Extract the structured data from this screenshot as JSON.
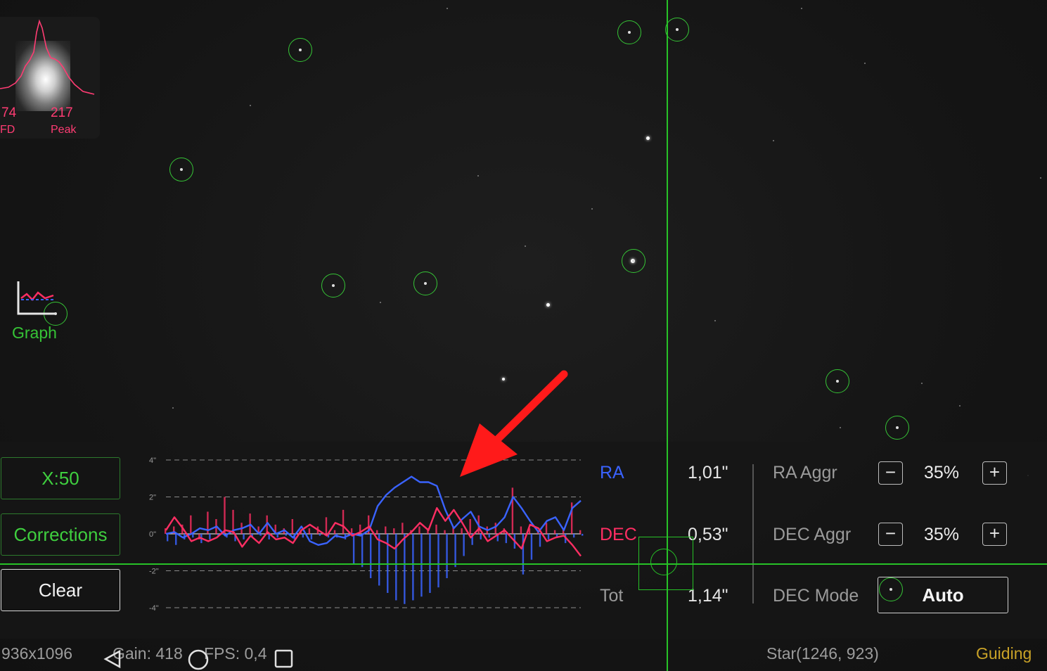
{
  "star_profile": {
    "fwhm_value": "74",
    "fwhm_label": "FD",
    "peak_value": "217",
    "peak_label": "Peak"
  },
  "graph_toggle": {
    "label": "Graph",
    "icon": "graph-icon"
  },
  "controls": {
    "scale_button": "X:50",
    "corrections_button": "Corrections",
    "clear_button": "Clear"
  },
  "stats": {
    "ra_label": "RA",
    "ra_value": "1,01\"",
    "dec_label": "DEC",
    "dec_value": "0,53\"",
    "tot_label": "Tot",
    "tot_value": "1,14\""
  },
  "aggressiveness": {
    "ra_label": "RA Aggr",
    "ra_value": "35%",
    "dec_label": "DEC Aggr",
    "dec_value": "35%",
    "minus": "−",
    "plus": "+",
    "mode_label": "DEC Mode",
    "mode_value": "Auto"
  },
  "status_bar": {
    "resolution": "936x1096",
    "gain": "Gain: 418",
    "fps": "FPS: 0,4",
    "star": "Star(1246, 923)",
    "state": "Guiding"
  },
  "colors": {
    "ra": "#3a63ff",
    "dec": "#ff2e63",
    "accent": "#36c436",
    "guiding": "#c9a227",
    "arrow": "#ff1a1a"
  },
  "chart_data": {
    "type": "line",
    "y_tick_labels": [
      "4\"",
      "2\"",
      "0\"",
      "-2\"",
      "-4\""
    ],
    "ylim": [
      -4,
      4
    ],
    "grid": true,
    "x": [
      1,
      2,
      3,
      4,
      5,
      6,
      7,
      8,
      9,
      10,
      11,
      12,
      13,
      14,
      15,
      16,
      17,
      18,
      19,
      20,
      21,
      22,
      23,
      24,
      25,
      26,
      27,
      28,
      29,
      30,
      31,
      32,
      33,
      34,
      35,
      36,
      37,
      38,
      39,
      40,
      41,
      42,
      43,
      44,
      45,
      46,
      47,
      48,
      49,
      50
    ],
    "series": [
      {
        "name": "RA",
        "color": "#3a63ff",
        "values": [
          0.0,
          0.1,
          -0.2,
          0.0,
          0.3,
          0.2,
          0.4,
          -0.1,
          0.2,
          0.3,
          0.5,
          0.0,
          0.6,
          0.0,
          0.2,
          -0.2,
          0.4,
          -0.4,
          -0.6,
          -0.5,
          -0.1,
          -0.2,
          0.0,
          -0.1,
          0.2,
          1.5,
          2.1,
          2.5,
          2.8,
          3.1,
          2.8,
          2.8,
          2.6,
          1.3,
          0.3,
          0.8,
          1.2,
          0.4,
          0.2,
          0.4,
          0.9,
          2.0,
          1.4,
          0.7,
          0.1,
          0.7,
          0.9,
          0.2,
          1.4,
          1.8
        ]
      },
      {
        "name": "DEC",
        "color": "#ff2e63",
        "values": [
          0.2,
          0.9,
          0.3,
          -0.4,
          -0.2,
          -0.4,
          -0.2,
          0.2,
          0.1,
          -0.7,
          -0.1,
          -0.5,
          0.1,
          -0.3,
          -0.2,
          -0.5,
          0.2,
          0.5,
          0.2,
          -0.1,
          0.6,
          0.4,
          -0.1,
          0.1,
          0.4,
          -0.3,
          -0.5,
          -0.8,
          -0.3,
          0.1,
          0.6,
          0.2,
          1.4,
          0.7,
          1.3,
          0.6,
          -0.2,
          0.3,
          -0.4,
          -0.1,
          0.2,
          -0.3,
          -0.8,
          0.5,
          0.3,
          -0.4,
          -0.2,
          -0.1,
          -0.6,
          -1.2
        ]
      }
    ],
    "correction_bars": {
      "ra": [
        -0.4,
        -0.6,
        -0.3,
        -0.2,
        -0.5,
        -0.3,
        -0.1,
        -0.2,
        -0.4,
        -0.3,
        -0.2,
        -0.1,
        -0.3,
        -0.2,
        -0.1,
        -0.3,
        -0.2,
        -0.3,
        -0.1,
        -0.2,
        -0.2,
        -0.3,
        -1.6,
        -1.8,
        -2.4,
        -2.8,
        -3.2,
        -3.6,
        -3.8,
        -3.6,
        -3.4,
        -3.2,
        -2.9,
        -2.4,
        -1.8,
        -1.2,
        -0.6,
        -0.3,
        -0.2,
        -0.4,
        -0.5,
        -0.8,
        -2.2,
        -1.4,
        -0.7,
        -0.3,
        -0.2,
        -0.5,
        -0.2,
        -0.1
      ],
      "dec": [
        0.3,
        0.4,
        0.5,
        1.0,
        -0.3,
        1.2,
        0.8,
        2.0,
        1.3,
        0.6,
        1.1,
        0.4,
        1.0,
        0.5,
        0.3,
        0.8,
        0.2,
        0.3,
        0.4,
        0.9,
        0.2,
        1.3,
        0.3,
        0.5,
        1.0,
        0.2,
        0.4,
        0.3,
        0.6,
        0.2,
        0.4,
        0.3,
        0.5,
        0.2,
        0.4,
        0.3,
        0.8,
        1.0,
        0.4,
        0.6,
        0.3,
        2.5,
        0.4,
        0.3,
        0.2,
        0.6,
        0.2,
        0.3,
        1.7,
        0.2
      ]
    }
  }
}
